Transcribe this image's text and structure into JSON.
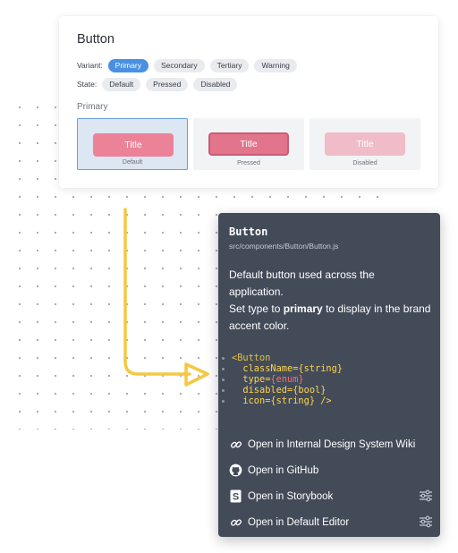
{
  "card": {
    "title": "Button",
    "variant_label": "Variant:",
    "variants": [
      "Primary",
      "Secondary",
      "Tertiary",
      "Warning"
    ],
    "state_label": "State:",
    "states": [
      "Default",
      "Pressed",
      "Disabled"
    ],
    "section": "Primary",
    "previews": [
      {
        "button": "Title",
        "caption": "Default"
      },
      {
        "button": "Title",
        "caption": "Pressed"
      },
      {
        "button": "Title",
        "caption": "Disabled"
      }
    ]
  },
  "panel": {
    "title": "Button",
    "path": "src/components/Button/Button.js",
    "desc_line1": "Default button used across the application.",
    "desc_pre": "Set type to ",
    "desc_bold": "primary",
    "desc_post": " to display in the brand accent color.",
    "code": {
      "open": "<Button",
      "props": [
        {
          "name": "className",
          "value": "{string}"
        },
        {
          "name": "type",
          "value": "{enum}"
        },
        {
          "name": "disabled",
          "value": "{bool}"
        },
        {
          "name": "icon",
          "value": "{string}"
        }
      ],
      "close": " />"
    },
    "links": [
      {
        "label": "Open in Internal Design System Wiki",
        "icon": "link-icon"
      },
      {
        "label": "Open in GitHub",
        "icon": "github-icon"
      },
      {
        "label": "Open in Storybook",
        "icon": "storybook-icon"
      },
      {
        "label": "Open in Default Editor",
        "icon": "link-icon"
      }
    ]
  },
  "colors": {
    "accent": "#4a90e2",
    "panel_bg": "#434b59",
    "arrow": "#f4c842",
    "button_pink": "#ec8298"
  }
}
